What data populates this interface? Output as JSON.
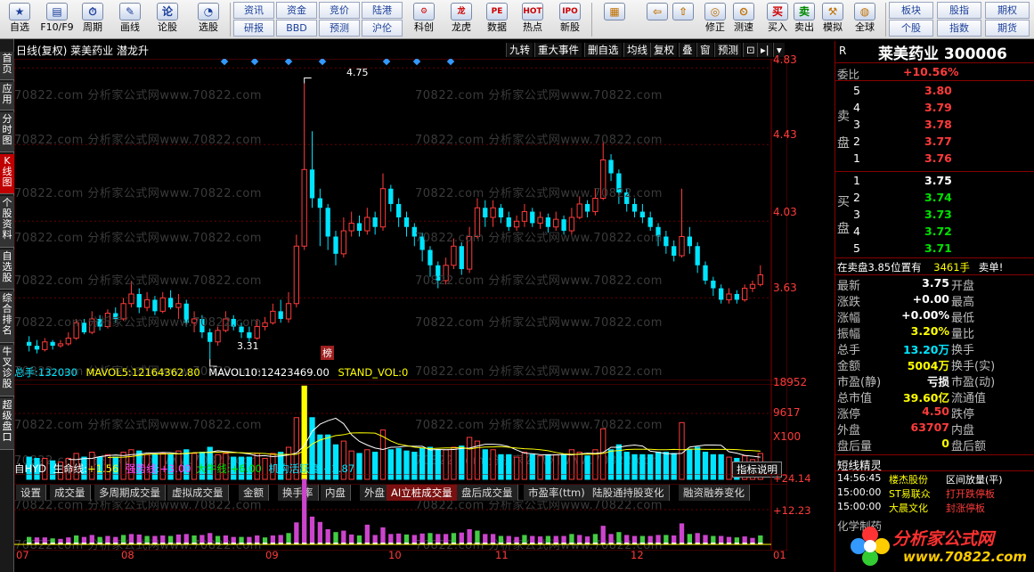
{
  "toolbar": {
    "items": [
      {
        "label": "自选",
        "icon": "star-icon",
        "glyph": "★"
      },
      {
        "label": "F10/F9",
        "icon": "info-icon",
        "glyph": "▤"
      },
      {
        "label": "周期",
        "icon": "clock-icon",
        "glyph": "⏱"
      },
      {
        "label": "画线",
        "icon": "pencil-icon",
        "glyph": "✎"
      },
      {
        "label": "论股",
        "icon": "chat-icon",
        "glyph": "论"
      },
      {
        "label": "选股",
        "icon": "chart-pick-icon",
        "glyph": "◔"
      }
    ],
    "grid_top": [
      "资讯",
      "资金",
      "竞价",
      "陆港"
    ],
    "grid_bottom": [
      "研报",
      "BBD",
      "预测",
      "沪伦"
    ],
    "items2": [
      {
        "label": "科创",
        "icon": "brain-icon",
        "glyph": "⚙"
      },
      {
        "label": "龙虎",
        "icon": "dragon-icon",
        "glyph": "龙"
      },
      {
        "label": "数据",
        "icon": "pe-icon",
        "glyph": "PE"
      },
      {
        "label": "热点",
        "icon": "hot-icon",
        "glyph": "HOT"
      },
      {
        "label": "新股",
        "icon": "ipo-icon",
        "glyph": "IPO"
      }
    ],
    "items3": [
      {
        "label": "",
        "icon": "grid-layout-icon",
        "glyph": "▦"
      },
      {
        "label": "",
        "icon": "back-arrow-icon",
        "glyph": "⇦"
      },
      {
        "label": "",
        "icon": "up-arrow-icon",
        "glyph": "⇧"
      },
      {
        "label": "修正",
        "icon": "repair-icon",
        "glyph": "◎"
      },
      {
        "label": "测速",
        "icon": "speed-icon",
        "glyph": "⏲"
      },
      {
        "label": "买入",
        "icon": "buy-icon",
        "glyph": "买"
      },
      {
        "label": "卖出",
        "icon": "sell-icon",
        "glyph": "卖"
      },
      {
        "label": "模拟",
        "icon": "gavel-icon",
        "glyph": "⚒"
      },
      {
        "label": "全球",
        "icon": "globe-icon",
        "glyph": "◍"
      }
    ],
    "grid2_top": [
      "板块",
      "股指",
      "期权"
    ],
    "grid2_bottom": [
      "个股",
      "指数",
      "期货"
    ]
  },
  "sidebar": [
    "首页",
    "应用",
    "分时图",
    "K线图",
    "个股资料",
    "自选股",
    "综合排名",
    "牛叉诊股",
    "超级盘口"
  ],
  "chart": {
    "header_title": "日线(复权) 莱美药业 潜龙升",
    "header_buttons": [
      "九转",
      "重大事件",
      "删自选",
      "均线",
      "复权",
      "叠",
      "窗",
      "预测"
    ],
    "price_axis": [
      "4.83",
      "4.43",
      "4.03",
      "3.63"
    ],
    "high_label": "4.75",
    "low_label": "3.31",
    "bang_label": "榜",
    "watermark": "70822.com 分析家公式网www.70822.com",
    "volume_legend": {
      "total_label": "总手:",
      "total": "132030",
      "mavol5_label": "MAVOL5:",
      "mavol5": "12164362.80",
      "mavol10_label": "MAVOL10:",
      "mavol10": "12423469.00",
      "stand_label": "STAND_VOL:",
      "stand": "0"
    },
    "volume_axis": [
      "18952",
      "9617",
      "X100"
    ],
    "tabs": [
      "设置",
      "成交量",
      "多周期成交量",
      "虚拟成交量",
      "金额",
      "换手率",
      "内盘",
      "外盘",
      "AI立桩成交量",
      "盘后成交量",
      "市盈率(ttm)",
      "陆股通持股变化",
      "融资融券变化"
    ],
    "active_tab": "AI立桩成交量",
    "indicator_legend": {
      "name": "自HYD",
      "l1": "生命线:",
      "v1": "+1.56",
      "l2": "强势线:",
      "v2": "+3.00",
      "l3": "大牛线:",
      "v3": "+6.00",
      "l4": "机构活跃度:",
      "v4": "+2.87"
    },
    "indicator_button": "指标说明",
    "indicator_axis": [
      "+24.14",
      "+12.23"
    ],
    "months": [
      "07",
      "08",
      "09",
      "10",
      "11",
      "12",
      "01"
    ]
  },
  "colors": {
    "up": "#ff3b3b",
    "down": "#00e5ff",
    "ma5": "#ffffff",
    "ma10": "#ffff00",
    "bg": "#000000"
  },
  "chart_data": {
    "type": "candlestick",
    "price_ylim": [
      3.25,
      4.85
    ],
    "price_ticks": [
      4.83,
      4.43,
      4.03,
      3.63
    ],
    "high": 4.75,
    "low": 3.31,
    "x_months": [
      "07",
      "08",
      "09",
      "10",
      "11",
      "12",
      "01"
    ],
    "candles": [
      [
        3.4,
        3.38,
        3.43,
        3.35
      ],
      [
        3.38,
        3.36,
        3.41,
        3.34
      ],
      [
        3.36,
        3.4,
        3.42,
        3.35
      ],
      [
        3.4,
        3.38,
        3.41,
        3.36
      ],
      [
        3.38,
        3.39,
        3.41,
        3.37
      ],
      [
        3.39,
        3.42,
        3.45,
        3.38
      ],
      [
        3.42,
        3.5,
        3.52,
        3.41
      ],
      [
        3.5,
        3.45,
        3.52,
        3.44
      ],
      [
        3.45,
        3.52,
        3.56,
        3.44
      ],
      [
        3.52,
        3.48,
        3.54,
        3.46
      ],
      [
        3.48,
        3.55,
        3.57,
        3.47
      ],
      [
        3.55,
        3.52,
        3.58,
        3.5
      ],
      [
        3.52,
        3.6,
        3.63,
        3.51
      ],
      [
        3.6,
        3.65,
        3.72,
        3.58
      ],
      [
        3.65,
        3.58,
        3.68,
        3.55
      ],
      [
        3.58,
        3.62,
        3.66,
        3.56
      ],
      [
        3.62,
        3.56,
        3.64,
        3.54
      ],
      [
        3.56,
        3.63,
        3.66,
        3.55
      ],
      [
        3.63,
        3.58,
        3.67,
        3.57
      ],
      [
        3.58,
        3.6,
        3.65,
        3.52
      ],
      [
        3.6,
        3.5,
        3.62,
        3.48
      ],
      [
        3.5,
        3.52,
        3.56,
        3.45
      ],
      [
        3.52,
        3.45,
        3.54,
        3.42
      ],
      [
        3.45,
        3.4,
        3.47,
        3.31
      ],
      [
        3.4,
        3.46,
        3.48,
        3.38
      ],
      [
        3.46,
        3.52,
        3.56,
        3.45
      ],
      [
        3.52,
        3.48,
        3.54,
        3.46
      ],
      [
        3.48,
        3.45,
        3.5,
        3.42
      ],
      [
        3.45,
        3.42,
        3.48,
        3.4
      ],
      [
        3.42,
        3.48,
        3.52,
        3.41
      ],
      [
        3.48,
        3.5,
        3.53,
        3.46
      ],
      [
        3.5,
        3.56,
        3.6,
        3.49
      ],
      [
        3.56,
        3.52,
        3.62,
        3.5
      ],
      [
        3.52,
        3.6,
        3.66,
        3.5
      ],
      [
        3.6,
        3.9,
        3.96,
        3.58
      ],
      [
        3.9,
        4.3,
        4.75,
        3.88
      ],
      [
        4.3,
        4.15,
        4.5,
        4.1
      ],
      [
        4.15,
        4.1,
        4.2,
        3.9
      ],
      [
        4.1,
        3.95,
        4.12,
        3.88
      ],
      [
        3.95,
        3.86,
        3.98,
        3.8
      ],
      [
        3.86,
        3.98,
        4.05,
        3.84
      ],
      [
        3.98,
        4.02,
        4.08,
        3.95
      ],
      [
        4.02,
        3.98,
        4.06,
        3.95
      ],
      [
        3.98,
        4.05,
        4.1,
        3.96
      ],
      [
        4.05,
        4.0,
        4.08,
        3.96
      ],
      [
        4.0,
        4.2,
        4.28,
        3.98
      ],
      [
        4.2,
        4.12,
        4.22,
        4.08
      ],
      [
        4.12,
        4.05,
        4.15,
        4.0
      ],
      [
        4.05,
        4.0,
        4.08,
        3.95
      ],
      [
        4.0,
        3.95,
        4.02,
        3.9
      ],
      [
        3.95,
        3.88,
        3.97,
        3.82
      ],
      [
        3.88,
        3.8,
        3.9,
        3.74
      ],
      [
        3.8,
        3.72,
        3.82,
        3.68
      ],
      [
        3.72,
        3.8,
        3.84,
        3.7
      ],
      [
        3.8,
        3.9,
        3.94,
        3.78
      ],
      [
        3.9,
        3.78,
        3.92,
        3.75
      ],
      [
        3.78,
        3.95,
        4.0,
        3.76
      ],
      [
        3.95,
        4.1,
        4.15,
        3.94
      ],
      [
        4.1,
        4.05,
        4.14,
        4.0
      ],
      [
        4.05,
        4.1,
        4.14,
        4.0
      ],
      [
        4.1,
        4.05,
        4.12,
        4.02
      ],
      [
        4.05,
        4.0,
        4.08,
        3.98
      ],
      [
        4.0,
        4.03,
        4.06,
        3.98
      ],
      [
        4.03,
        4.08,
        4.12,
        4.0
      ],
      [
        4.08,
        4.02,
        4.1,
        4.0
      ],
      [
        4.02,
        4.05,
        4.08,
        3.99
      ],
      [
        4.05,
        4.0,
        4.07,
        3.97
      ],
      [
        4.0,
        4.04,
        4.08,
        3.98
      ],
      [
        4.04,
        3.98,
        4.06,
        3.96
      ],
      [
        3.98,
        4.05,
        4.1,
        3.96
      ],
      [
        4.05,
        4.12,
        4.16,
        4.04
      ],
      [
        4.12,
        4.08,
        4.14,
        4.05
      ],
      [
        4.08,
        4.15,
        4.2,
        4.06
      ],
      [
        4.15,
        4.35,
        4.45,
        4.14
      ],
      [
        4.35,
        4.28,
        4.38,
        4.24
      ],
      [
        4.28,
        4.18,
        4.3,
        4.12
      ],
      [
        4.18,
        4.12,
        4.2,
        4.08
      ],
      [
        4.12,
        4.08,
        4.15,
        4.05
      ],
      [
        4.08,
        4.05,
        4.12,
        4.02
      ],
      [
        4.05,
        4.0,
        4.08,
        3.98
      ],
      [
        4.0,
        3.95,
        4.02,
        3.9
      ],
      [
        3.95,
        3.9,
        3.98,
        3.86
      ],
      [
        3.9,
        3.85,
        3.93,
        3.82
      ],
      [
        3.85,
        3.95,
        4.2,
        3.84
      ],
      [
        3.95,
        3.9,
        4.0,
        3.86
      ],
      [
        3.9,
        3.8,
        3.92,
        3.76
      ],
      [
        3.8,
        3.72,
        3.82,
        3.7
      ],
      [
        3.72,
        3.68,
        3.74,
        3.64
      ],
      [
        3.68,
        3.62,
        3.7,
        3.6
      ],
      [
        3.62,
        3.65,
        3.68,
        3.6
      ],
      [
        3.65,
        3.62,
        3.67,
        3.6
      ],
      [
        3.62,
        3.68,
        3.7,
        3.61
      ],
      [
        3.68,
        3.7,
        3.72,
        3.66
      ],
      [
        3.7,
        3.75,
        3.8,
        3.69
      ]
    ],
    "volume": {
      "ylim": [
        0,
        19500
      ],
      "ticks": [
        18952,
        9617
      ],
      "unit": "X100",
      "mavol5": 12164362.8,
      "mavol10": 12423469.0,
      "total": 132030
    },
    "indicator": {
      "ticks": [
        24.14,
        12.23
      ],
      "lifeline": 1.56,
      "strong": 3.0,
      "bull": 6.0,
      "activity": 2.87
    }
  },
  "quote": {
    "title": "莱美药业 300006",
    "r_label": "R",
    "weibi_label": "委比",
    "weibi": "+10.56%",
    "sell_side": "卖盘",
    "buy_side": "买盘",
    "asks": [
      [
        "5",
        "3.80"
      ],
      [
        "4",
        "3.79"
      ],
      [
        "3",
        "3.78"
      ],
      [
        "2",
        "3.77"
      ],
      [
        "1",
        "3.76"
      ]
    ],
    "bids": [
      [
        "1",
        "3.75"
      ],
      [
        "2",
        "3.74"
      ],
      [
        "3",
        "3.73"
      ],
      [
        "4",
        "3.72"
      ],
      [
        "5",
        "3.71"
      ]
    ],
    "ticker_text": "在卖盘3.85位置有",
    "ticker_vol": "3461手",
    "ticker_tag": "卖单!",
    "fields": [
      [
        "最新",
        "3.75",
        "开盘",
        ""
      ],
      [
        "涨跌",
        "+0.00",
        "最高",
        ""
      ],
      [
        "涨幅",
        "+0.00%",
        "最低",
        ""
      ],
      [
        "振幅",
        "3.20%",
        "量比",
        ""
      ],
      [
        "总手",
        "13.20万",
        "换手",
        ""
      ],
      [
        "金额",
        "5004万",
        "换手(实)",
        ""
      ],
      [
        "市盈(静)",
        "亏损",
        "市盈(动)",
        ""
      ],
      [
        "总市值",
        "39.60亿",
        "流通值",
        ""
      ],
      [
        "涨停",
        "4.50",
        "跌停",
        ""
      ],
      [
        "外盘",
        "63707",
        "内盘",
        ""
      ],
      [
        "盘后量",
        "0",
        "盘后额",
        ""
      ]
    ],
    "short_title": "短线精灵",
    "short_rows": [
      [
        "14:56:45",
        "楼杰股份",
        "区间放量(平)"
      ],
      [
        "15:00:00",
        "ST易联众",
        "打开跌停板"
      ],
      [
        "15:00:00",
        "大晨文化",
        "封涨停板"
      ]
    ],
    "short_cut": "化学制药",
    "brand": "分析家公式网",
    "brand_url": "www.70822.com"
  }
}
